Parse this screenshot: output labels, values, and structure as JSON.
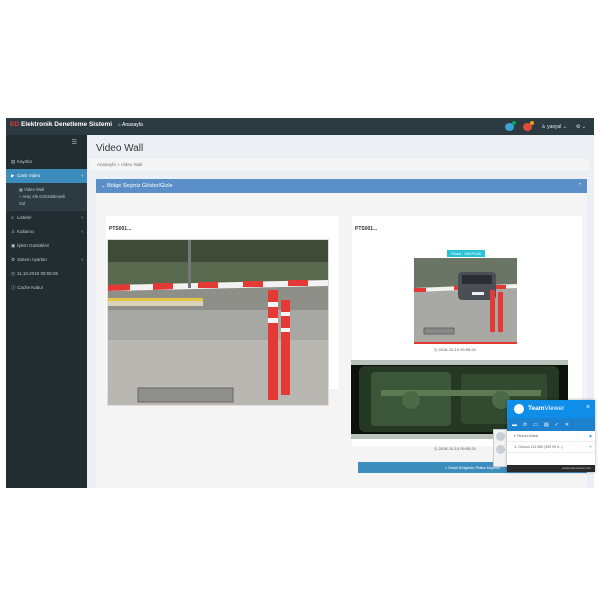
{
  "header": {
    "app_title": "Elektronik Denetleme Sistemi",
    "home_link": "Anasayfa",
    "user_name": "yasyal",
    "logo_mark": "ED"
  },
  "sidebar": {
    "items": [
      {
        "icon": "list-icon",
        "label": "Kayıtlar"
      },
      {
        "icon": "video-icon",
        "label": "Canlı Video"
      },
      {
        "icon": "list-icon",
        "label": "Listeler"
      },
      {
        "icon": "user-icon",
        "label": "Kullanıcı"
      },
      {
        "icon": "log-icon",
        "label": "İşlem Günlükleri"
      },
      {
        "icon": "gear-icon",
        "label": "Sistem Ayarları"
      },
      {
        "icon": "clock-icon",
        "label": "11.10.2018 09:55:06"
      },
      {
        "icon": "info-icon",
        "label": "Cache Kabul"
      }
    ],
    "sub_items": [
      {
        "label": "Video Wall"
      },
      {
        "label": "Araç Altı Görüntülemeli"
      },
      {
        "label": "Sol"
      }
    ]
  },
  "content": {
    "page_title": "Video Wall",
    "breadcrumb": "Anasayfa  >  Video Wall",
    "panel_title": "Bölge Seçiniz Göster/Gizle",
    "cam_left_label": "PTS001...",
    "cam_right_label": "PTS001...",
    "plate_badge": "Plaka : 06KP436",
    "timestamp_plate": "2018-10-10 09:55:24",
    "timestamp_under": "2018-10-10 09:55:24",
    "bottom_button": "Seçili Bölgenin Plaka Kaydını"
  },
  "teamviewer": {
    "brand_team": "Team",
    "brand_viewer": "Viewer",
    "row1": "Oturum listesi",
    "row2": "Oturum 113 865 (395 09 6...)",
    "footer": "www.teamviewer.com"
  },
  "colors": {
    "topbar": "#2c3b41",
    "sidebar": "#222d32",
    "active": "#3c8dbc",
    "panel_head": "#5b8fc7",
    "teamviewer": "#0e8ee9",
    "barrier_red": "#e53935"
  }
}
